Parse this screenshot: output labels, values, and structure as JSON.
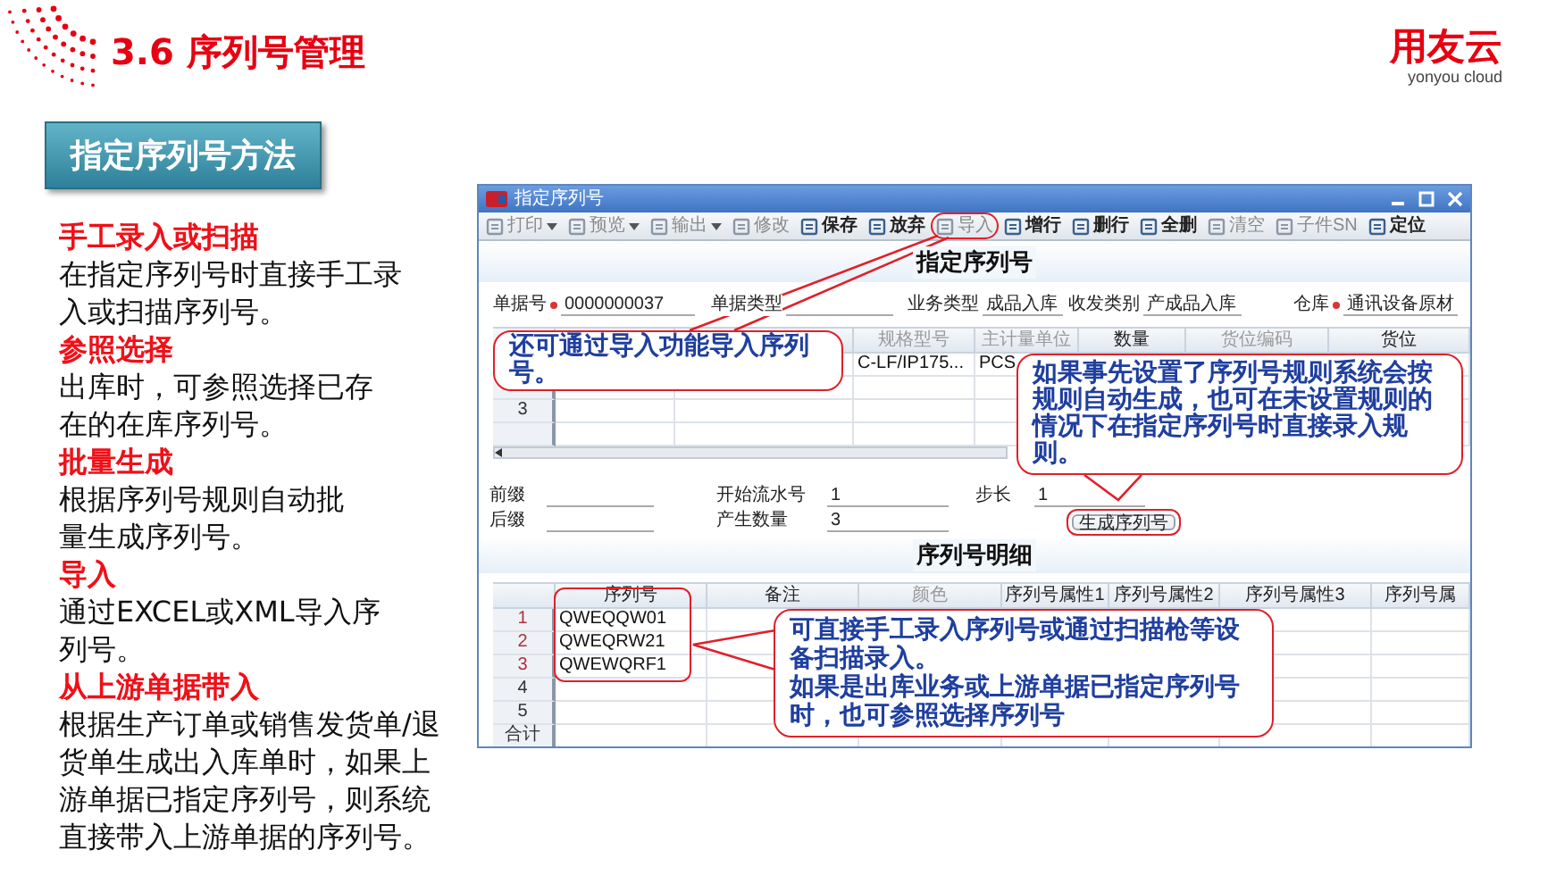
{
  "slide": {
    "title": "3.6 序列号管理",
    "logo": {
      "name": "用友云",
      "tagline": "yonyou cloud"
    },
    "section_label": "指定序列号方法"
  },
  "methods": [
    {
      "title": "手工录入或扫描",
      "lines": [
        "在指定序列号时直接手工录",
        "入或扫描序列号。"
      ]
    },
    {
      "title": "参照选择",
      "lines": [
        "出库时，可参照选择已存",
        "在的在库序列号。"
      ]
    },
    {
      "title": "批量生成",
      "lines": [
        "根据序列号规则自动批",
        "量生成序列号。"
      ]
    },
    {
      "title": "导入",
      "lines": [
        "通过EXCEL或XML导入序",
        "列号。"
      ]
    },
    {
      "title": "从上游单据带入",
      "lines": [
        "根据生产订单或销售发货单/退",
        "货单生成出入库单时，如果上",
        "游单据已指定序列号，则系统",
        "直接带入上游单据的序列号。"
      ]
    }
  ],
  "window": {
    "title": "指定序列号",
    "toolbar": [
      {
        "label": "打印",
        "disabled": true,
        "has_menu": true,
        "highlighted": false
      },
      {
        "label": "预览",
        "disabled": true,
        "has_menu": true,
        "highlighted": false
      },
      {
        "label": "输出",
        "disabled": true,
        "has_menu": true,
        "highlighted": false
      },
      {
        "label": "修改",
        "disabled": true,
        "has_menu": false,
        "highlighted": false
      },
      {
        "label": "保存",
        "disabled": false,
        "has_menu": false,
        "highlighted": false
      },
      {
        "label": "放弃",
        "disabled": false,
        "has_menu": false,
        "highlighted": false
      },
      {
        "label": "导入",
        "disabled": true,
        "has_menu": false,
        "highlighted": true
      },
      {
        "label": "增行",
        "disabled": false,
        "has_menu": false,
        "highlighted": false
      },
      {
        "label": "删行",
        "disabled": false,
        "has_menu": false,
        "highlighted": false
      },
      {
        "label": "全删",
        "disabled": false,
        "has_menu": false,
        "highlighted": false
      },
      {
        "label": "清空",
        "disabled": true,
        "has_menu": false,
        "highlighted": false
      },
      {
        "label": "子件SN",
        "disabled": true,
        "has_menu": false,
        "highlighted": false
      },
      {
        "label": "定位",
        "disabled": false,
        "has_menu": false,
        "highlighted": false
      }
    ],
    "heading": "指定序列号",
    "form": [
      {
        "label": "单据号",
        "required": true,
        "value": "0000000037"
      },
      {
        "label": "单据类型",
        "required": false
      },
      {
        "label": "业务类型",
        "required": false,
        "value": "成品入库"
      },
      {
        "label": "收发类别",
        "required": false,
        "value": "产成品入库"
      },
      {
        "label": "仓库",
        "required": true,
        "value": "通讯设备原材"
      }
    ],
    "item_table": {
      "columns": [
        {},
        {},
        {
          "label": "规格型号",
          "disabled": true
        },
        {
          "label": "主计量单位",
          "disabled": true
        },
        {
          "label": "数量",
          "disabled": false
        },
        {
          "label": "货位编码",
          "disabled": true
        },
        {
          "label": "货位",
          "disabled": false
        }
      ],
      "rows": [
        {
          "spec_model": "C-LF/IP175...",
          "unit": "PCS"
        },
        {},
        {
          "number": "3"
        },
        {}
      ]
    },
    "generator": {
      "fields": [
        {
          "label": "前缀"
        },
        {
          "label": "开始流水号",
          "value": "1"
        },
        {
          "label": "步长",
          "value": "1"
        },
        {
          "label": "后缀"
        },
        {
          "label": "产生数量",
          "value": "3"
        }
      ],
      "button": {
        "label": "生成序列号",
        "highlighted": true
      }
    },
    "detail_heading": "序列号明细",
    "serial_table": {
      "columns": [
        {
          "label": "序列号",
          "disabled": false,
          "highlighted": true
        },
        {
          "label": "备注",
          "disabled": false,
          "highlighted": false
        },
        {
          "label": "颜色",
          "disabled": true,
          "highlighted": false
        },
        {
          "label": "序列号属性1",
          "disabled": false,
          "highlighted": false
        },
        {
          "label": "序列号属性2",
          "disabled": false,
          "highlighted": false
        },
        {
          "label": "序列号属性3",
          "disabled": false,
          "highlighted": false
        },
        {
          "label": "序列号属",
          "disabled": false,
          "highlighted": false
        }
      ],
      "rows": [
        {
          "number": "1",
          "serial": "QWEQQW01"
        },
        {
          "number": "2",
          "serial": "QWEQRW21"
        },
        {
          "number": "3",
          "serial": "QWEWQRF1"
        },
        {
          "number": "4"
        },
        {
          "number": "5"
        }
      ],
      "total_label": "合计"
    },
    "callouts": [
      {
        "paragraphs": [
          "还可通过导入功能导入序列号。"
        ]
      },
      {
        "paragraphs": [
          "如果事先设置了序列号规则系统会按规则自动生成，也可在未设置规则的情况下在指定序列号时直接录入规则。"
        ]
      },
      {
        "paragraphs": [
          "可直接手工录入序列号或通过扫描枪等设备扫描录入。",
          "如果是出库业务或上游单据已指定序列号时，也可参照选择序列号"
        ]
      }
    ]
  }
}
